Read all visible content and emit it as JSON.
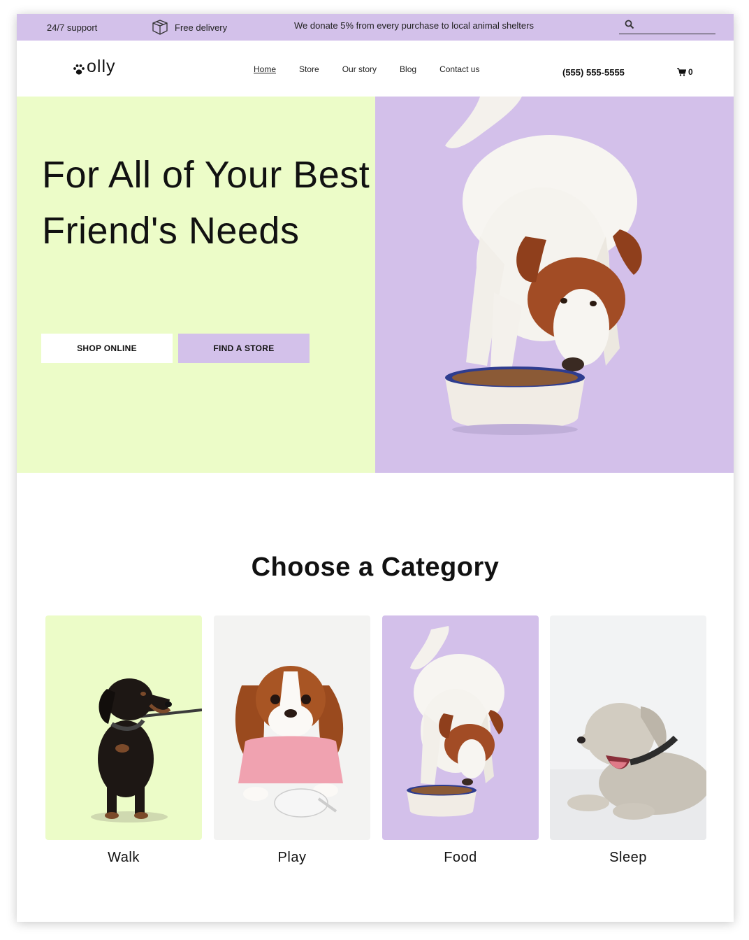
{
  "topbar": {
    "support": "24/7 support",
    "delivery": "Free delivery",
    "donate": "We donate 5% from every purchase to local animal shelters",
    "search_icon": "search-icon",
    "delivery_icon": "box-icon"
  },
  "header": {
    "logo_text": "olly",
    "logo_icon": "paw-icon",
    "nav": [
      {
        "label": "Home"
      },
      {
        "label": "Store"
      },
      {
        "label": "Our story"
      },
      {
        "label": "Blog"
      },
      {
        "label": "Contact us"
      }
    ],
    "phone": "(555) 555-5555",
    "cart_count": "0",
    "cart_icon": "cart-icon"
  },
  "hero": {
    "title": "For All of Your Best Friend's Needs",
    "shop_button": "SHOP ONLINE",
    "store_button": "FIND A STORE"
  },
  "categories": {
    "title": "Choose a Category",
    "items": [
      {
        "label": "Walk"
      },
      {
        "label": "Play"
      },
      {
        "label": "Food"
      },
      {
        "label": "Sleep"
      }
    ]
  },
  "colors": {
    "lavender": "#d3c1ea",
    "lime": "#ecfcc8",
    "text": "#111111"
  }
}
